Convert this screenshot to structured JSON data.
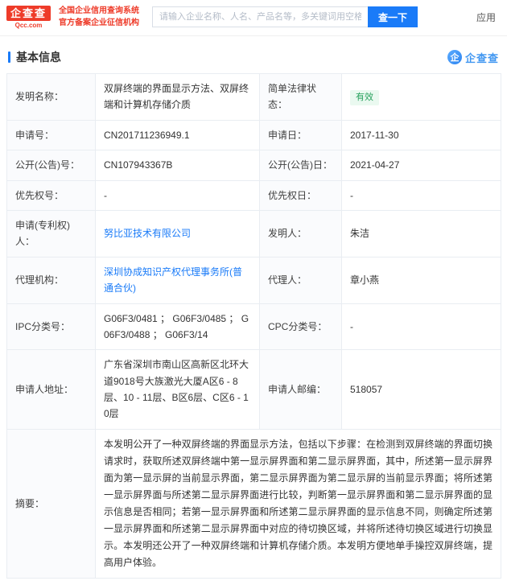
{
  "header": {
    "logo": {
      "name": "企查查",
      "domain": "Qcc.com"
    },
    "slogan_line1": "全国企业信用查询系统",
    "slogan_line2": "官方备案企业征信机构",
    "search": {
      "placeholder": "请输入企业名称、人名、产品名等，多关键词用空格隔开",
      "button": "查一下"
    },
    "app_label": "应用"
  },
  "section": {
    "title": "基本信息",
    "watermark_icon": "企",
    "watermark": "企查查"
  },
  "rows": [
    {
      "label1": "发明名称：",
      "value1": "双屏终端的界面显示方法、双屏终端和计算机存储介质",
      "label2": "简单法律状态：",
      "value2": "有效"
    },
    {
      "label1": "申请号：",
      "value1": "CN201711236949.1",
      "label2": "申请日：",
      "value2": "2017-11-30"
    },
    {
      "label1": "公开(公告)号：",
      "value1": "CN107943367B",
      "label2": "公开(公告)日：",
      "value2": "2021-04-27"
    },
    {
      "label1": "优先权号：",
      "value1": "-",
      "label2": "优先权日：",
      "value2": "-"
    },
    {
      "label1": "申请(专利权)人：",
      "value1": "努比亚技术有限公司",
      "label2": "发明人：",
      "value2": "朱洁"
    },
    {
      "label1": "代理机构：",
      "value1": "深圳协成知识产权代理事务所(普通合伙)",
      "label2": "代理人：",
      "value2": "章小燕"
    },
    {
      "label1": "IPC分类号：",
      "value1": "G06F3/0481 ； G06F3/0485 ； G06F3/0488 ； G06F3/14",
      "label2": "CPC分类号：",
      "value2": "-"
    },
    {
      "label1": "申请人地址：",
      "value1": "广东省深圳市南山区高新区北环大道9018号大族激光大厦A区6 - 8层、10 - 11层、B区6层、C区6 - 10层",
      "label2": "申请人邮编：",
      "value2": "518057"
    }
  ],
  "abstract": {
    "label": "摘要：",
    "text": "本发明公开了一种双屏终端的界面显示方法，包括以下步骤：在检测到双屏终端的界面切换请求时，获取所述双屏终端中第一显示屏界面和第二显示屏界面，其中，所述第一显示屏界面为第一显示屏的当前显示界面，第二显示屏界面为第二显示屏的当前显示界面；将所述第一显示屏界面与所述第二显示屏界面进行比较，判断第一显示屏界面和第二显示屏界面的显示信息是否相同；若第一显示屏界面和所述第二显示屏界面的显示信息不同，则确定所述第一显示屏界面和所述第二显示屏界面中对应的待切换区域，并将所述待切换区域进行切换显示。本发明还公开了一种双屏终端和计算机存储介质。本发明方便地单手操控双屏终端，提高用户体验。"
  },
  "colors": {
    "brand_red": "#ee3b29",
    "accent_blue": "#1a7bf8",
    "badge_green": "#26a05c",
    "badge_bg": "#eaf9f0",
    "label_cell_bg": "#fafbfd",
    "table_border": "#e9edf2"
  }
}
